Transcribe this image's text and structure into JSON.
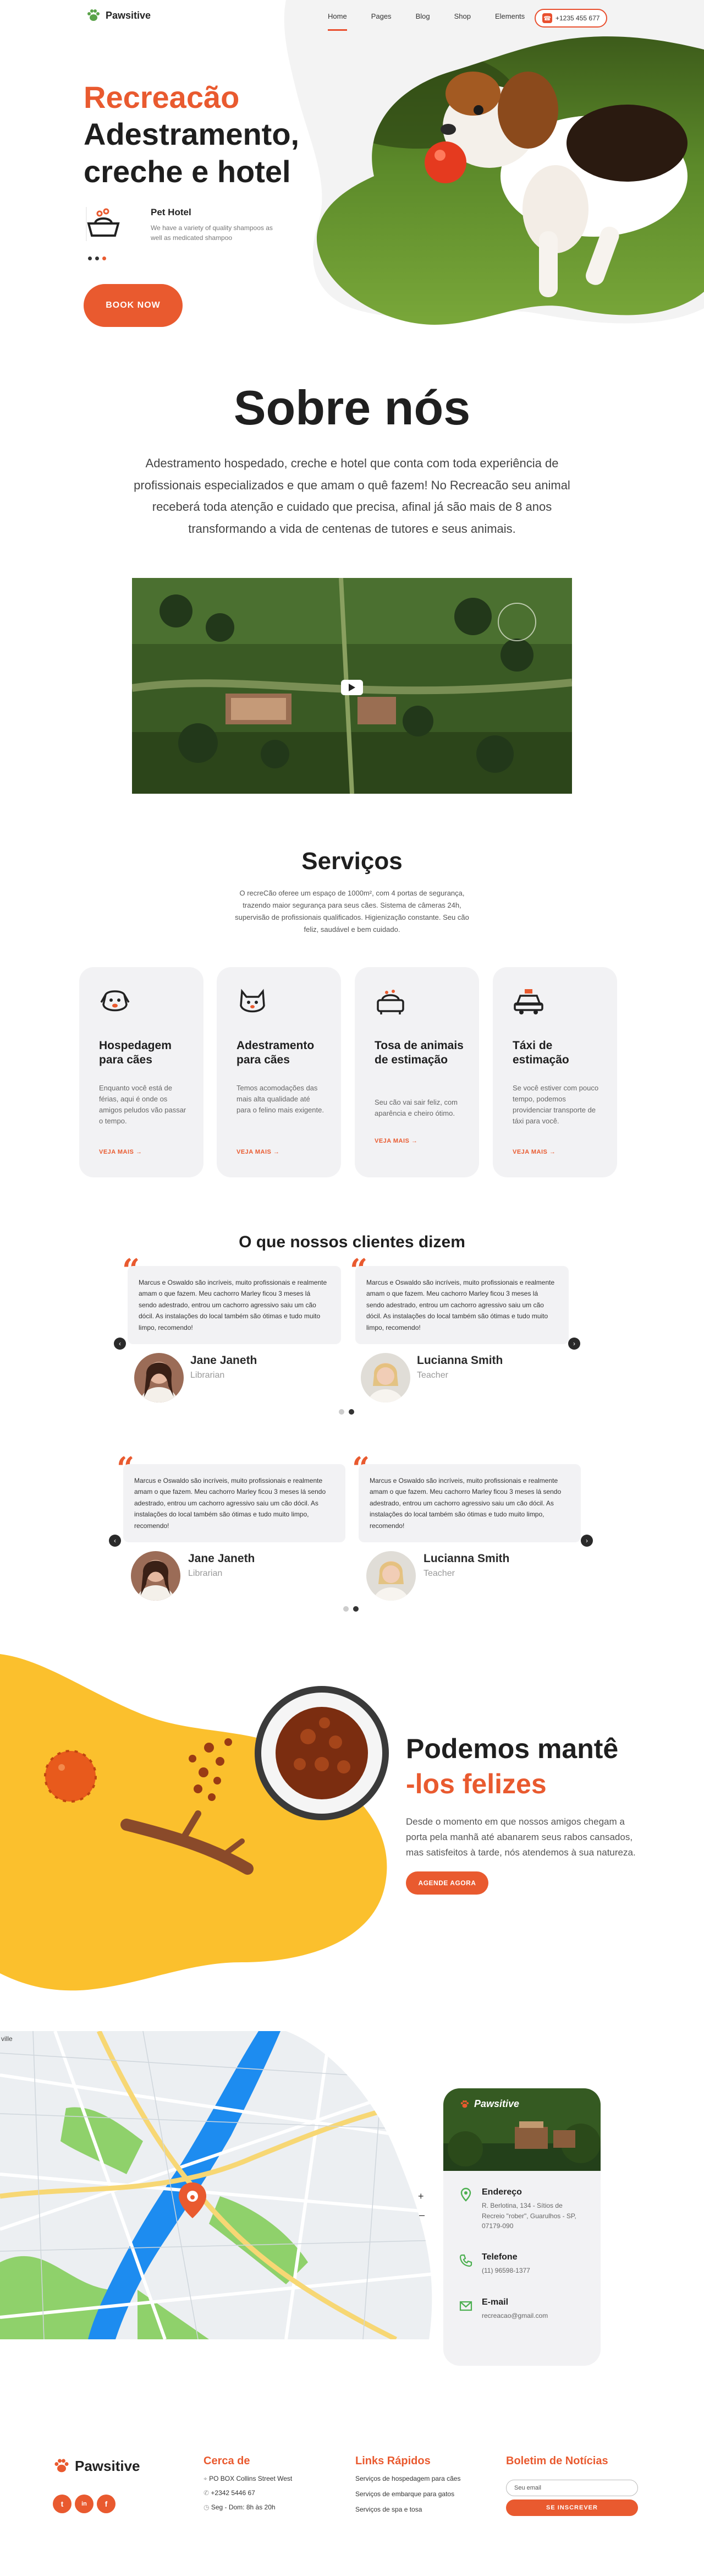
{
  "header": {
    "brand": "Pawsitive",
    "nav": [
      "Home",
      "Pages",
      "Blog",
      "Shop",
      "Elements"
    ],
    "phone": "+1235 455 677"
  },
  "hero": {
    "title_line1": "Recreacão",
    "title_line2": "Adestramento,",
    "title_line3": "creche e hotel",
    "feature_title": "Pet Hotel",
    "feature_desc": "We have a variety of quality shampoos as well as medicated shampoo",
    "book_label": "BOOK NOW"
  },
  "about": {
    "title": "Sobre nós",
    "text": "Adestramento hospedado, creche e hotel que conta com toda experiência de profissionais especializados e que amam o quê fazem! No Recreacão seu animal receberá toda atenção e cuidado que precisa, afinal já são mais de 8 anos transformando a vida de centenas de tutores e seus animais."
  },
  "services": {
    "title": "Serviços",
    "desc": "O recreCão oferee um espaço de 1000m², com 4 portas de segurança, trazendo maior segurança para seus cães. Sistema de câmeras 24h, supervisão de profissionais qualificados. Higienização constante. Seu cão feliz, saudável e bem cuidado.",
    "more_label": "VEJA MAIS",
    "cards": [
      {
        "title": "Hospedagem para cães",
        "desc": "Enquanto você está de férias, aqui é onde os amigos peludos vão passar o tempo.",
        "icon": "dog-icon"
      },
      {
        "title": "Adestramento para cães",
        "desc": "Temos acomodações das mais alta qualidade até para o felino mais exigente.",
        "icon": "cat-icon"
      },
      {
        "title": "Tosa de animais de estimação",
        "desc": "Seu cão vai sair feliz, com aparência e cheiro ótimo.",
        "icon": "bath-icon"
      },
      {
        "title": "Táxi de estimação",
        "desc": "Se você estiver com pouco tempo, podemos providenciar transporte de táxi para você.",
        "icon": "taxi-icon"
      }
    ]
  },
  "testimonials": {
    "title": "O que nossos clientes dizem",
    "quote": "Marcus e Oswaldo são incríveis, muito profissionais e realmente amam o que fazem. Meu cachorro Marley ficou 3 meses lá sendo adestrado, entrou um cachorro agressivo saiu um cão dócil. As instalações do local também são ótimas e tudo muito limpo, recomendo!",
    "people": [
      {
        "name": "Jane Janeth",
        "role": "Librarian"
      },
      {
        "name": "Lucianna Smith",
        "role": "Teacher"
      }
    ]
  },
  "food": {
    "title_line1": "Podemos mantê",
    "title_line2": "-los felizes",
    "desc": "Desde o momento em que nossos amigos chegam a porta pela manhã até abanarem seus rabos cansados, mas satisfeitos à tarde, nós atendemos à sua natureza.",
    "button": "AGENDE AGORA"
  },
  "contact": {
    "brand": "Pawsitive",
    "address_label": "Endereço",
    "address": "R. Berlotina, 134 - Sítios de Recreio \"rober\", Guarulhos - SP, 07179-090",
    "phone_label": "Telefone",
    "phone": "(11) 96598-1377",
    "email_label": "E-mail",
    "email": "recreacao@gmail.com",
    "map_label": "ville"
  },
  "footer": {
    "brand": "Pawsitive",
    "col1_title": "Cerca de",
    "col1_items": [
      "PO BOX Collins Street West",
      "+2342 5446 67",
      "Seg - Dom: 8h às 20h"
    ],
    "col2_title": "Links Rápidos",
    "col2_items": [
      "Serviços de hospedagem para cães",
      "Serviços de embarque para gatos",
      "Serviços de spa e tosa"
    ],
    "col3_title": "Boletim de Notícias",
    "email_placeholder": "Seu email",
    "subscribe": "SE INSCREVER",
    "social": [
      "t",
      "in",
      "f"
    ]
  },
  "colors": {
    "accent": "#e95a2f",
    "yellow": "#fbc02d",
    "dark": "#1f1f1f"
  }
}
